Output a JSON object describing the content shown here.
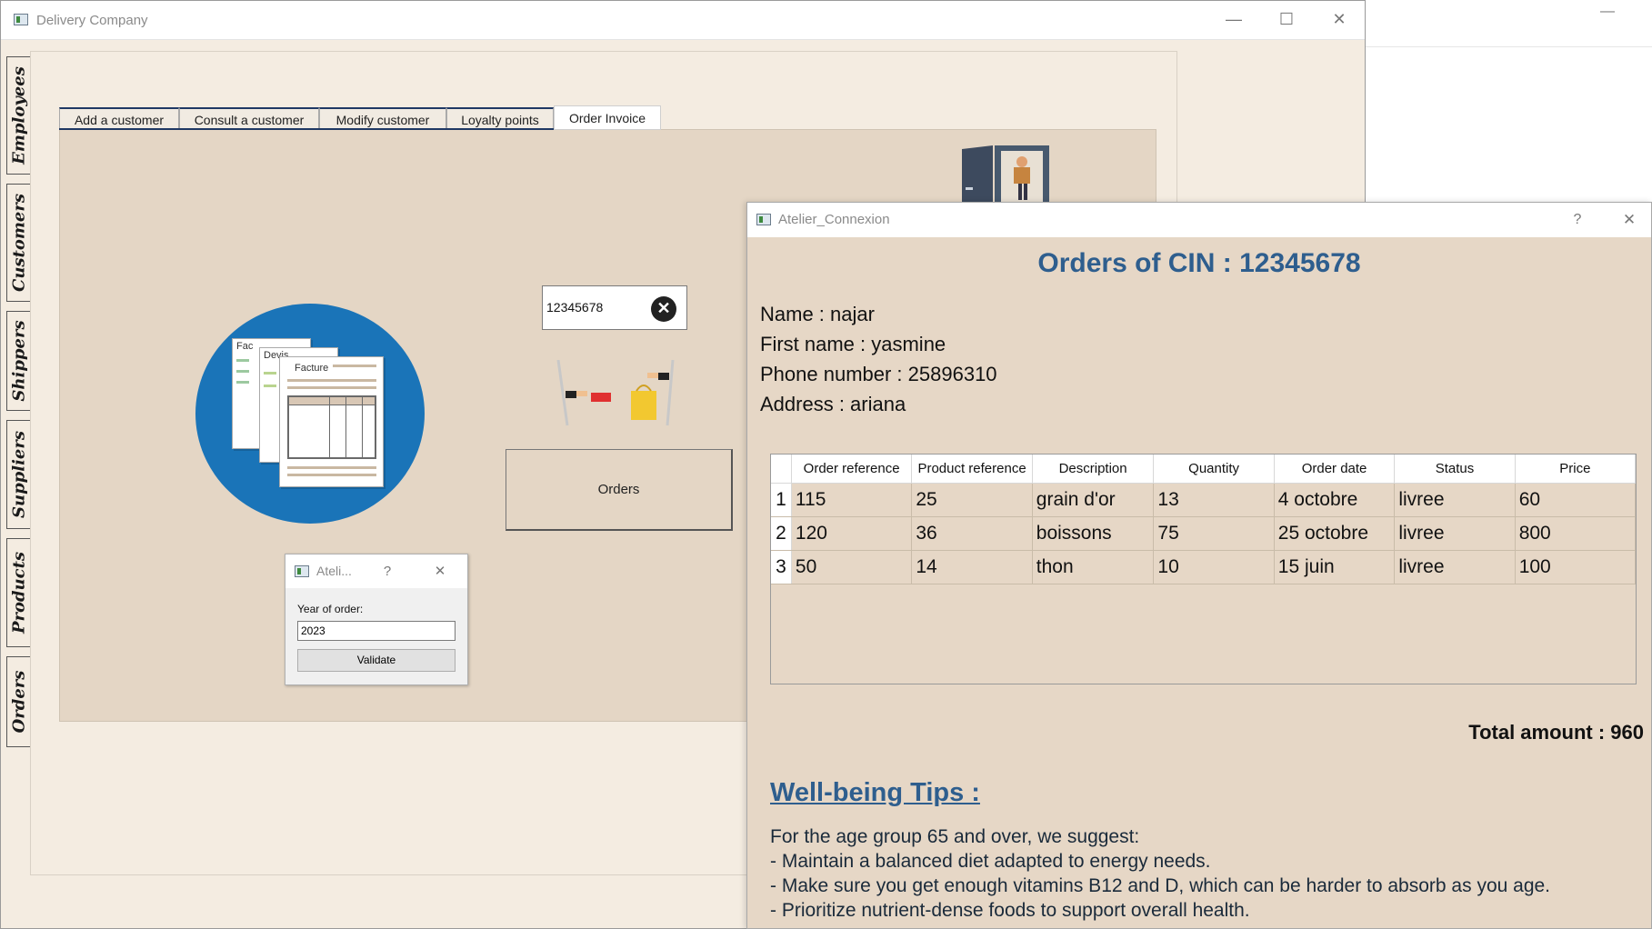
{
  "main_window": {
    "title": "Delivery Company",
    "controls": {
      "minimize": "—",
      "maximize": "☐",
      "close": "✕"
    }
  },
  "side_tabs": [
    "Employees",
    "Customers",
    "Shippers",
    "Suppliers",
    "Products",
    "Orders"
  ],
  "customer_tabs": [
    {
      "label": "Add a customer",
      "active": false
    },
    {
      "label": "Consult a customer",
      "active": false
    },
    {
      "label": "Modify customer",
      "active": false
    },
    {
      "label": "Loyalty points",
      "active": false
    },
    {
      "label": "Order Invoice",
      "active": true
    }
  ],
  "invoice_panel": {
    "documents": [
      "Fac",
      "Devis",
      "Facture"
    ],
    "search": {
      "value": "12345678"
    },
    "orders_button": "Orders"
  },
  "year_dialog": {
    "title": "Ateli...",
    "help": "?",
    "close": "✕",
    "year_label": "Year of order:",
    "year_value": "2023",
    "validate_button": "Validate"
  },
  "orders_dialog": {
    "title": "Atelier_Connexion",
    "help": "?",
    "close": "✕",
    "heading": "Orders of CIN : 12345678",
    "name": "Name : najar",
    "first_name": "First name : yasmine",
    "phone": "Phone number : 25896310",
    "address": "Address : ariana",
    "table": {
      "columns": [
        "Order reference",
        "Product reference",
        "Description",
        "Quantity",
        "Order date",
        "Status",
        "Price"
      ],
      "rows": [
        [
          "1",
          "115",
          "25",
          "grain d'or",
          "13",
          "4 octobre",
          "livree",
          "60"
        ],
        [
          "2",
          "120",
          "36",
          "boissons",
          "75",
          "25 octobre",
          "livree",
          "800"
        ],
        [
          "3",
          "50",
          "14",
          "thon",
          "10",
          "15 juin",
          "livree",
          "100"
        ]
      ]
    },
    "total": "Total amount : 960",
    "tips_heading": "Well-being Tips :",
    "tips": [
      "For the age group 65 and over, we suggest:",
      "- Maintain a balanced diet adapted to energy needs.",
      "- Make sure you get enough vitamins B12 and D, which can be harder to absorb as you age.",
      "- Prioritize nutrient-dense foods to support overall health."
    ]
  },
  "colors": {
    "heading_blue": "#2e5e8e",
    "panel_beige": "#e4d6c5",
    "window_beige": "#f4ece1",
    "invoice_circle": "#1a74b8"
  }
}
